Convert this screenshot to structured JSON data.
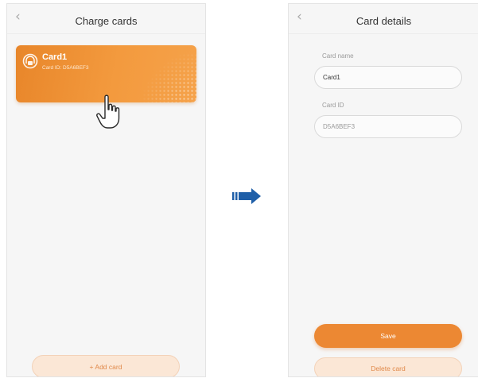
{
  "left_screen": {
    "back_icon": "chevron-left-icon",
    "title": "Charge cards",
    "card": {
      "icon": "card-chip-icon",
      "name": "Card1",
      "id_text": "Card ID: D5A6BEF3",
      "accent": "#ee8a2f"
    },
    "tap_indicator_icon": "pointing-hand-icon",
    "add_card_label": "+ Add card"
  },
  "transition_icon": "right-arrow-icon",
  "right_screen": {
    "back_icon": "chevron-left-icon",
    "title": "Card details",
    "card_name_label": "Card name",
    "card_name_value": "Card1",
    "card_id_label": "Card ID",
    "card_id_value": "D5A6BEF3",
    "save_label": "Save",
    "delete_label": "Delete card"
  },
  "colors": {
    "primary_orange": "#ec8833",
    "light_orange": "#fbe7d6",
    "arrow_blue": "#1f5fa8"
  }
}
